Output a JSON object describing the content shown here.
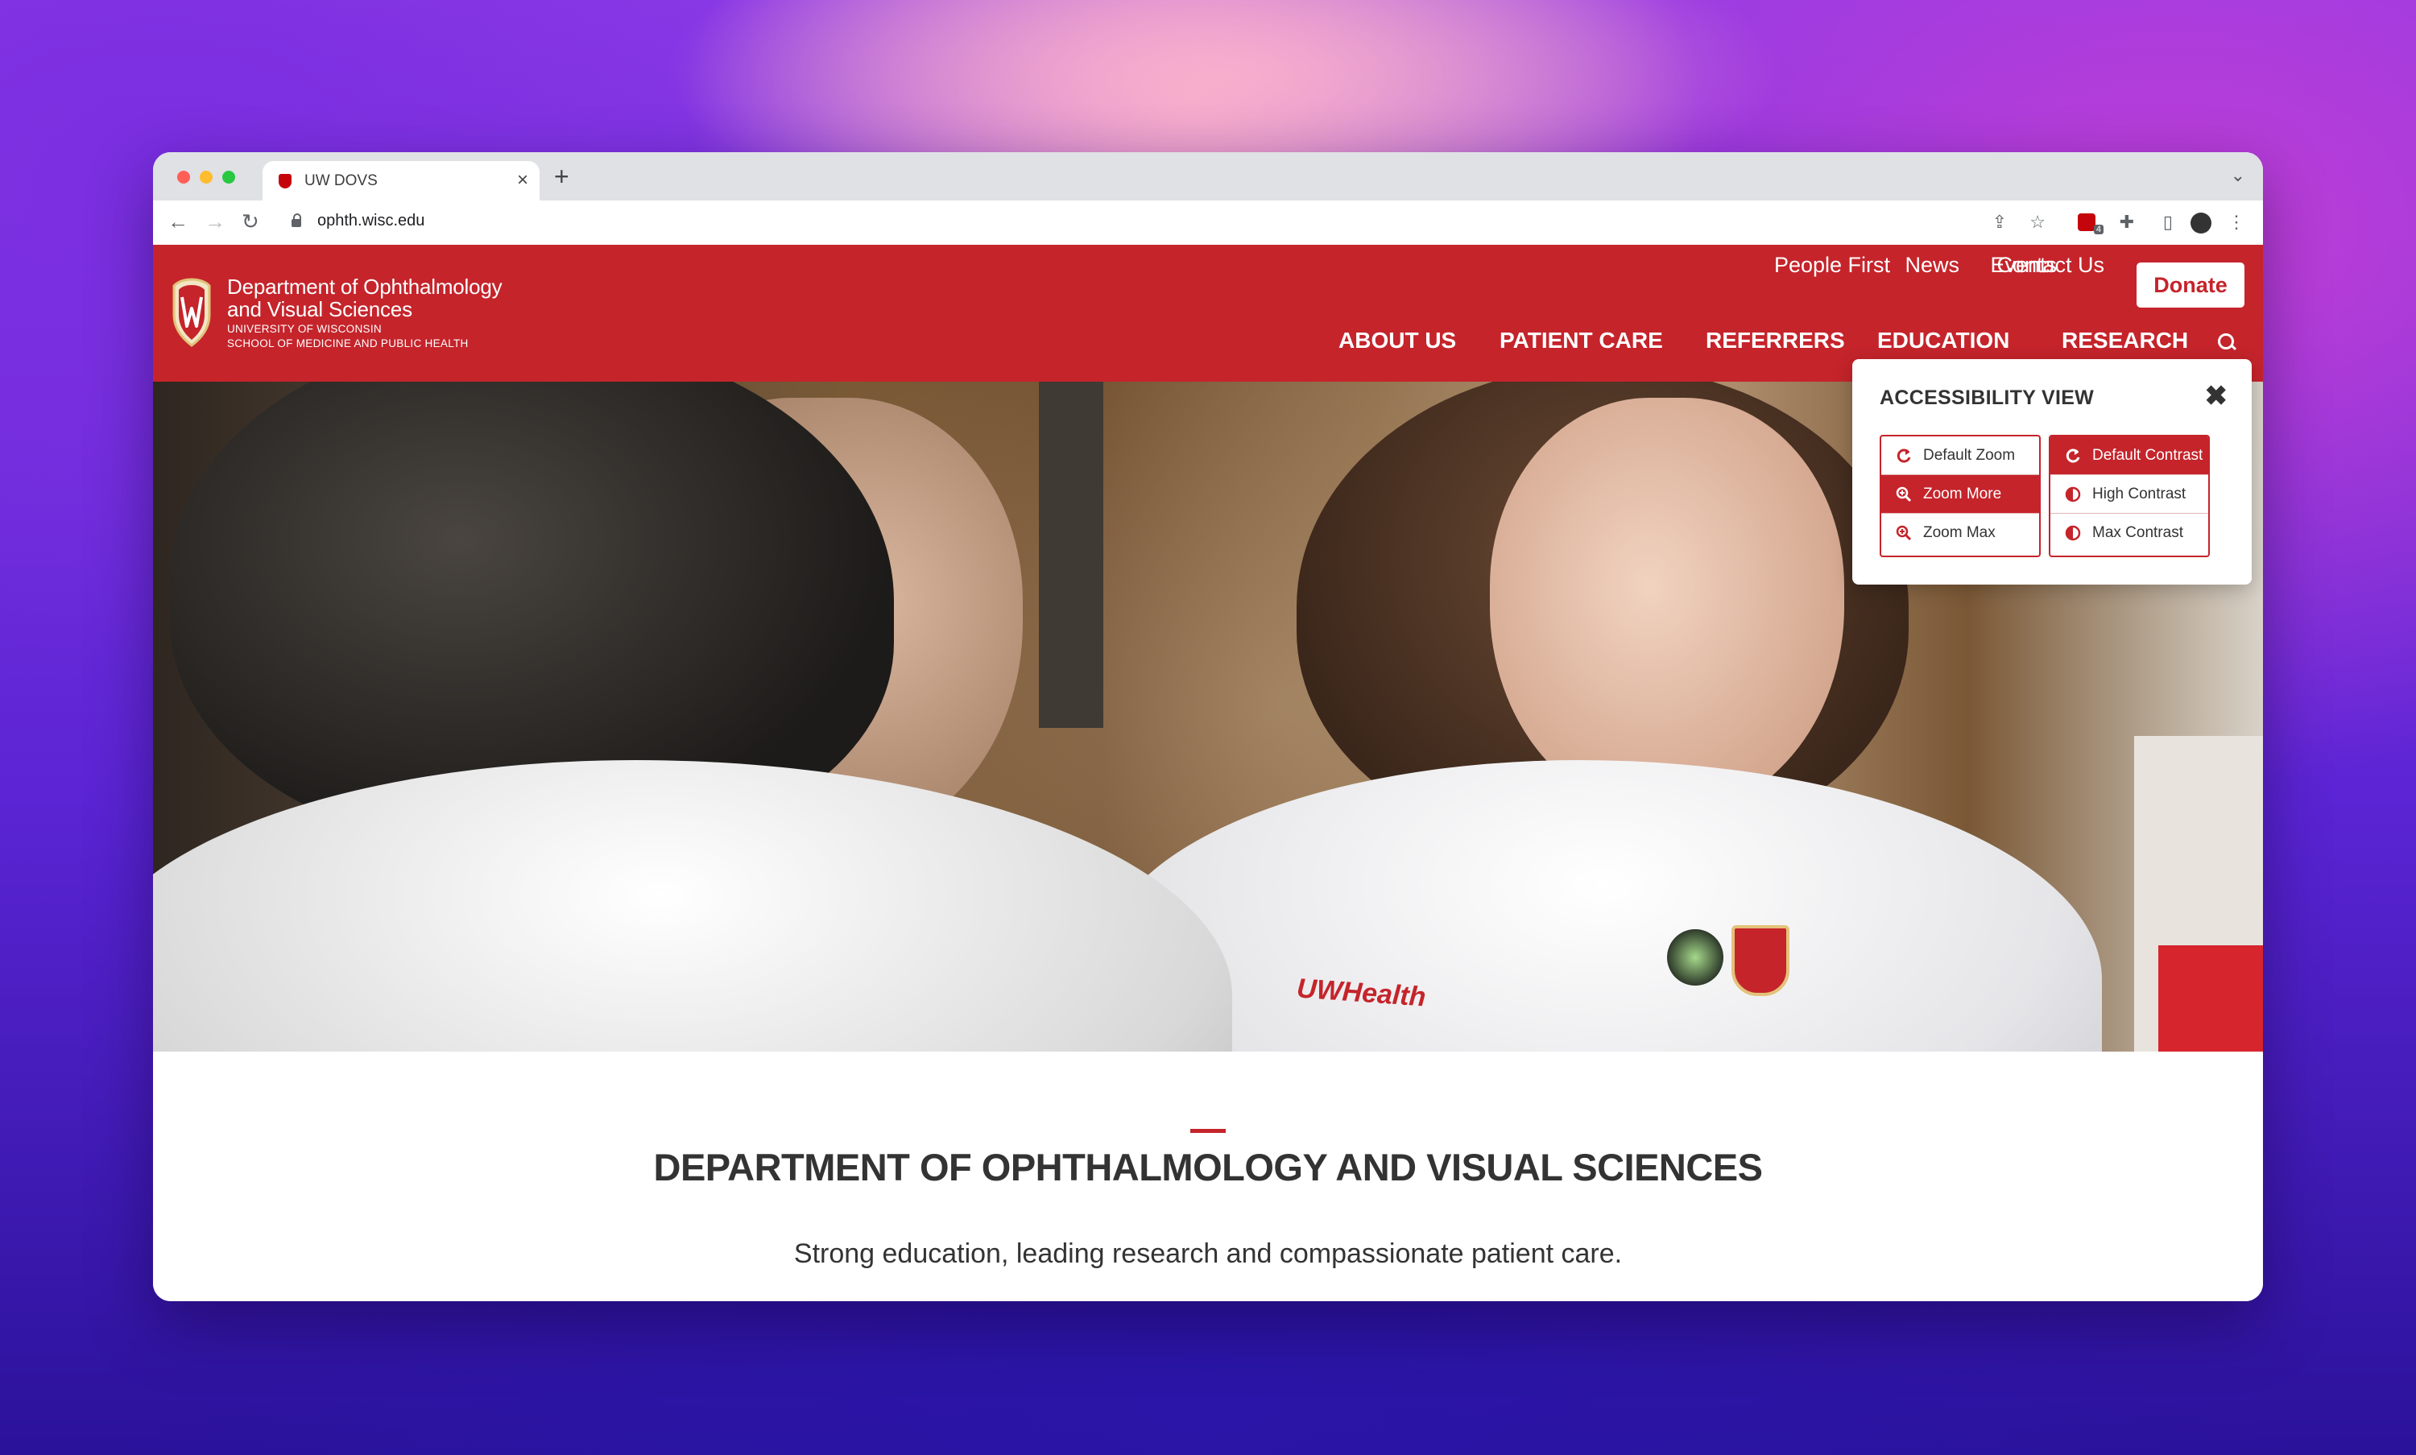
{
  "browser": {
    "tab_title": "UW DOVS",
    "url": "ophth.wisc.edu",
    "extension_badge": "4"
  },
  "brand": {
    "line1": "Department of Ophthalmology",
    "line2": "and Visual Sciences",
    "line3": "UNIVERSITY OF WISCONSIN",
    "line4": "SCHOOL OF MEDICINE AND PUBLIC HEALTH"
  },
  "utility_nav": {
    "people_first": "People First",
    "news": "News",
    "events": "Events",
    "contact_us": "Contact Us",
    "donate": "Donate"
  },
  "main_nav": {
    "about_us": "ABOUT US",
    "patient_care": "PATIENT CARE",
    "referrers": "REFERRERS",
    "education": "EDUCATION",
    "research": "RESEARCH"
  },
  "accessibility": {
    "title": "ACCESSIBILITY VIEW",
    "zoom": [
      "Default Zoom",
      "Zoom More",
      "Zoom Max"
    ],
    "contrast": [
      "Default Contrast",
      "High Contrast",
      "Max Contrast"
    ],
    "active_zoom": "Zoom More",
    "active_contrast": "Default Contrast"
  },
  "hero": {
    "coat_logo": "UWHealth"
  },
  "intro": {
    "title": "DEPARTMENT OF OPHTHALMOLOGY AND VISUAL SCIENCES",
    "subtitle": "Strong education, leading research and compassionate patient care."
  },
  "colors": {
    "brand_red": "#c5242b",
    "text_dark": "#333333"
  }
}
